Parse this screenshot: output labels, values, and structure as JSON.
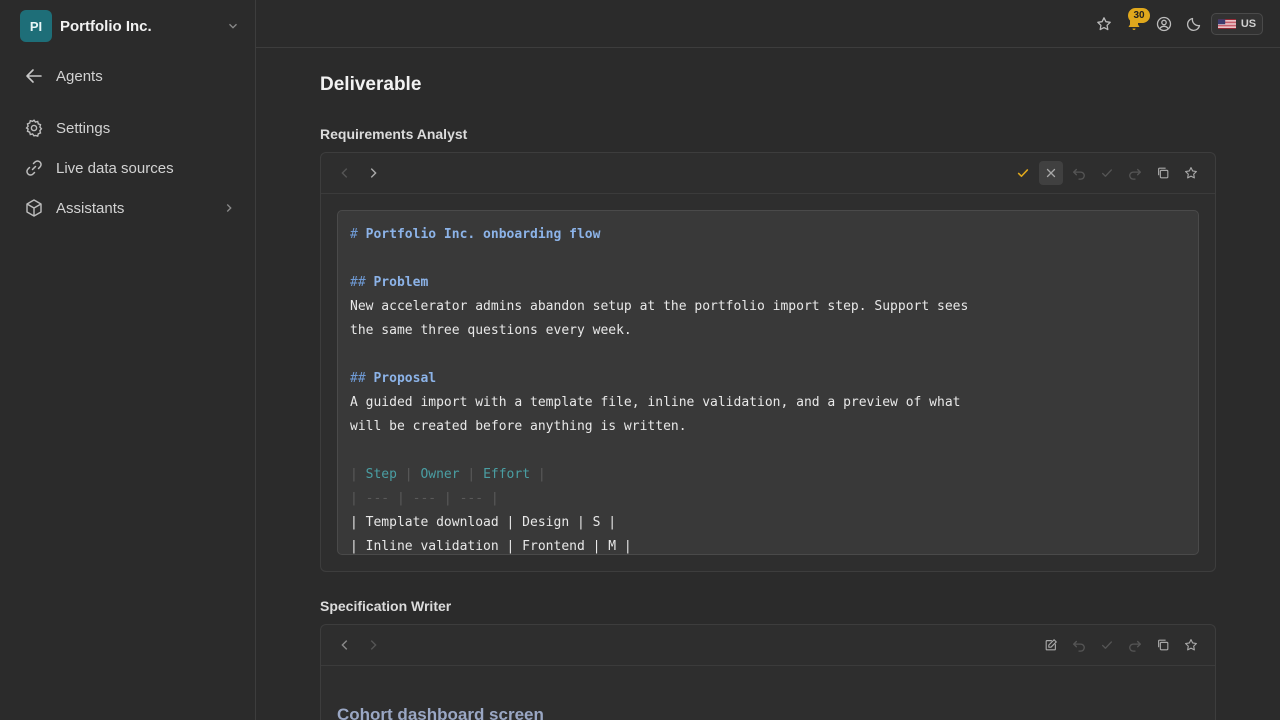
{
  "org": {
    "initials": "PI",
    "name": "Portfolio Inc."
  },
  "nav": {
    "back_label": "Agents",
    "items": [
      {
        "label": "Settings"
      },
      {
        "label": "Live data sources"
      },
      {
        "label": "Assistants"
      }
    ]
  },
  "topbar": {
    "notification_count": "30",
    "locale": "US"
  },
  "main": {
    "title": "Deliverable",
    "sections": [
      {
        "title": "Requirements Analyst",
        "document": {
          "h1_mark": "#",
          "h1": "Portfolio Inc. onboarding flow",
          "h2_mark": "##",
          "problem_heading": "Problem",
          "problem_line1": "New accelerator admins abandon setup at the portfolio import step. Support sees",
          "problem_line2": "the same three questions every week.",
          "proposal_heading": "Proposal",
          "proposal_line1": "A guided import with a template file, inline validation, and a preview of what",
          "proposal_line2": "will be created before anything is written.",
          "table_headers": [
            "Step",
            "Owner",
            "Effort"
          ],
          "table_rule": "| --- | --- | --- |",
          "table_rows": [
            "| Template download | Design | S |",
            "| Inline validation | Frontend | M |"
          ]
        }
      },
      {
        "title": "Specification Writer",
        "document": {
          "heading": "Cohort dashboard screen"
        }
      }
    ]
  },
  "colors": {
    "accent_check": "#e0a81c",
    "org_avatar": "#1e6e78",
    "badge": "#e0a81c"
  }
}
